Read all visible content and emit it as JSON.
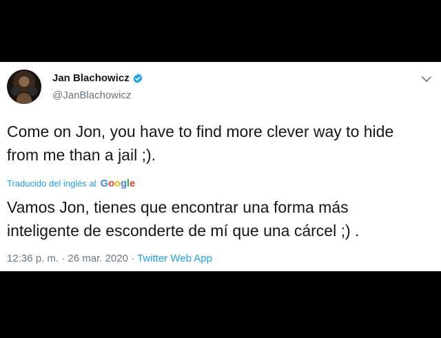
{
  "tweet": {
    "display_name": "Jan Blachowicz",
    "handle": "@JanBlachowicz",
    "text_line1": "Come on Jon, you have to find more clever way to hide",
    "text_line2": "from me than a jail ;).",
    "translated_label": "Traducido del inglés al",
    "google_letters": [
      "G",
      "o",
      "o",
      "g",
      "l",
      "e"
    ],
    "translation_line1": "Vamos Jon, tienes que encontrar una forma más",
    "translation_line2": "inteligente de esconderte de mí que una cárcel ;) .",
    "timestamp": "12:36 p. m. · 26 mar. 2020 · ",
    "source": "Twitter Web App"
  },
  "icons": {
    "verified": "verified-badge-icon",
    "menu": "chevron-down-icon"
  },
  "colors": {
    "background": "#000000",
    "card": "#ffffff",
    "link_blue": "#1da1f2",
    "muted": "#657786",
    "text": "#14171a"
  }
}
